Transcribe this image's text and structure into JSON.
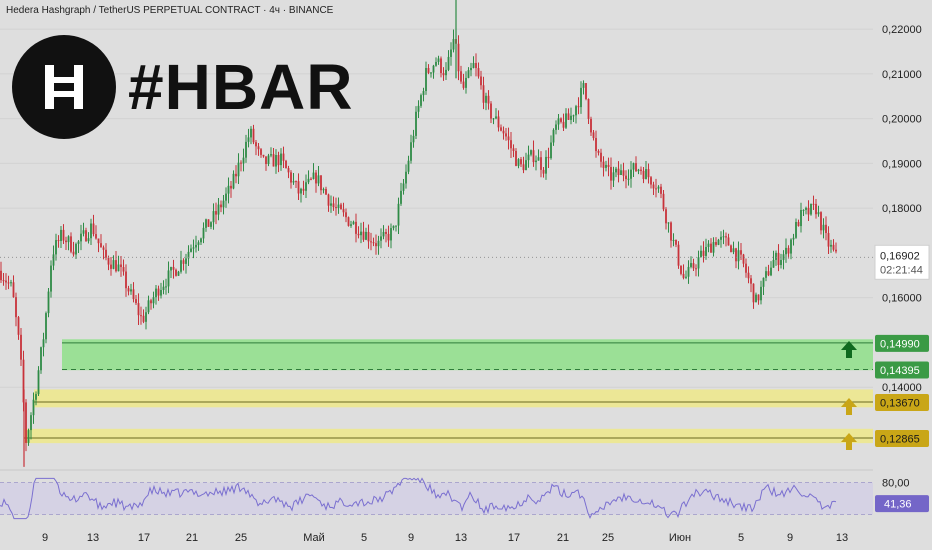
{
  "header": {
    "title": "Hedera Hashgraph / TetherUS PERPETUAL CONTRACT · 4ч · BINANCE",
    "ticker": "#HBAR",
    "logo_icon": "hbar-logo-icon"
  },
  "colors": {
    "up": "#2e8b46",
    "down": "#c8323a",
    "green_zone": "#8fe08a",
    "yellow_zone": "#efe98a",
    "rsi_line": "#7a6fd0",
    "rsi_badge": "#7466c8"
  },
  "chart_data": {
    "type": "candlestick",
    "title": "Hedera Hashgraph / TetherUS PERPETUAL CONTRACT · 4ч · BINANCE",
    "ylim": [
      0.1215,
      0.2265
    ],
    "y_ticks": [
      "0,22000",
      "0,21000",
      "0,20000",
      "0,19000",
      "0,18000",
      "0,16000",
      "0,14000"
    ],
    "x_ticks": [
      "9",
      "13",
      "17",
      "21",
      "25",
      "Май",
      "5",
      "9",
      "13",
      "17",
      "21",
      "25",
      "Июн",
      "5",
      "9",
      "13"
    ],
    "price_path": [
      [
        0,
        0.166
      ],
      [
        12,
        0.162
      ],
      [
        20,
        0.148
      ],
      [
        26,
        0.128
      ],
      [
        36,
        0.14
      ],
      [
        44,
        0.152
      ],
      [
        52,
        0.17
      ],
      [
        62,
        0.174
      ],
      [
        74,
        0.171
      ],
      [
        92,
        0.176
      ],
      [
        104,
        0.169
      ],
      [
        118,
        0.167
      ],
      [
        132,
        0.16
      ],
      [
        142,
        0.155
      ],
      [
        158,
        0.162
      ],
      [
        178,
        0.167
      ],
      [
        196,
        0.173
      ],
      [
        214,
        0.178
      ],
      [
        232,
        0.185
      ],
      [
        250,
        0.197
      ],
      [
        262,
        0.19
      ],
      [
        280,
        0.191
      ],
      [
        300,
        0.183
      ],
      [
        316,
        0.187
      ],
      [
        334,
        0.18
      ],
      [
        356,
        0.176
      ],
      [
        378,
        0.172
      ],
      [
        394,
        0.175
      ],
      [
        406,
        0.188
      ],
      [
        416,
        0.2
      ],
      [
        426,
        0.21
      ],
      [
        436,
        0.213
      ],
      [
        446,
        0.21
      ],
      [
        454,
        0.218
      ],
      [
        462,
        0.206
      ],
      [
        474,
        0.212
      ],
      [
        488,
        0.202
      ],
      [
        504,
        0.197
      ],
      [
        520,
        0.189
      ],
      [
        534,
        0.192
      ],
      [
        544,
        0.189
      ],
      [
        556,
        0.198
      ],
      [
        570,
        0.2
      ],
      [
        584,
        0.207
      ],
      [
        596,
        0.192
      ],
      [
        610,
        0.187
      ],
      [
        624,
        0.188
      ],
      [
        640,
        0.189
      ],
      [
        658,
        0.185
      ],
      [
        670,
        0.175
      ],
      [
        684,
        0.164
      ],
      [
        700,
        0.169
      ],
      [
        716,
        0.173
      ],
      [
        730,
        0.172
      ],
      [
        744,
        0.167
      ],
      [
        756,
        0.159
      ],
      [
        772,
        0.168
      ],
      [
        786,
        0.17
      ],
      [
        800,
        0.178
      ],
      [
        816,
        0.18
      ],
      [
        826,
        0.173
      ],
      [
        836,
        0.169
      ]
    ],
    "current_price": "0,16902",
    "countdown": "02:21:44",
    "levels": [
      {
        "label": "0,14990",
        "value": 0.1499,
        "color": "#3a9a45"
      },
      {
        "label": "0,14395",
        "value": 0.14395,
        "color": "#3a9a45"
      },
      {
        "label": "0,13670",
        "value": 0.1367,
        "color": "#c9a617"
      },
      {
        "label": "0,12865",
        "value": 0.12865,
        "color": "#c9a617"
      }
    ],
    "zones": [
      {
        "name": "green-support-zone",
        "top": 0.1507,
        "bottom": 0.1438
      },
      {
        "name": "yellow-support-zone-1",
        "top": 0.1395,
        "bottom": 0.1355
      },
      {
        "name": "yellow-support-zone-2",
        "top": 0.1307,
        "bottom": 0.1275
      }
    ],
    "rsi": {
      "upper_label": "80,00",
      "value": "41,36",
      "upper": 80,
      "lower": 20
    }
  }
}
